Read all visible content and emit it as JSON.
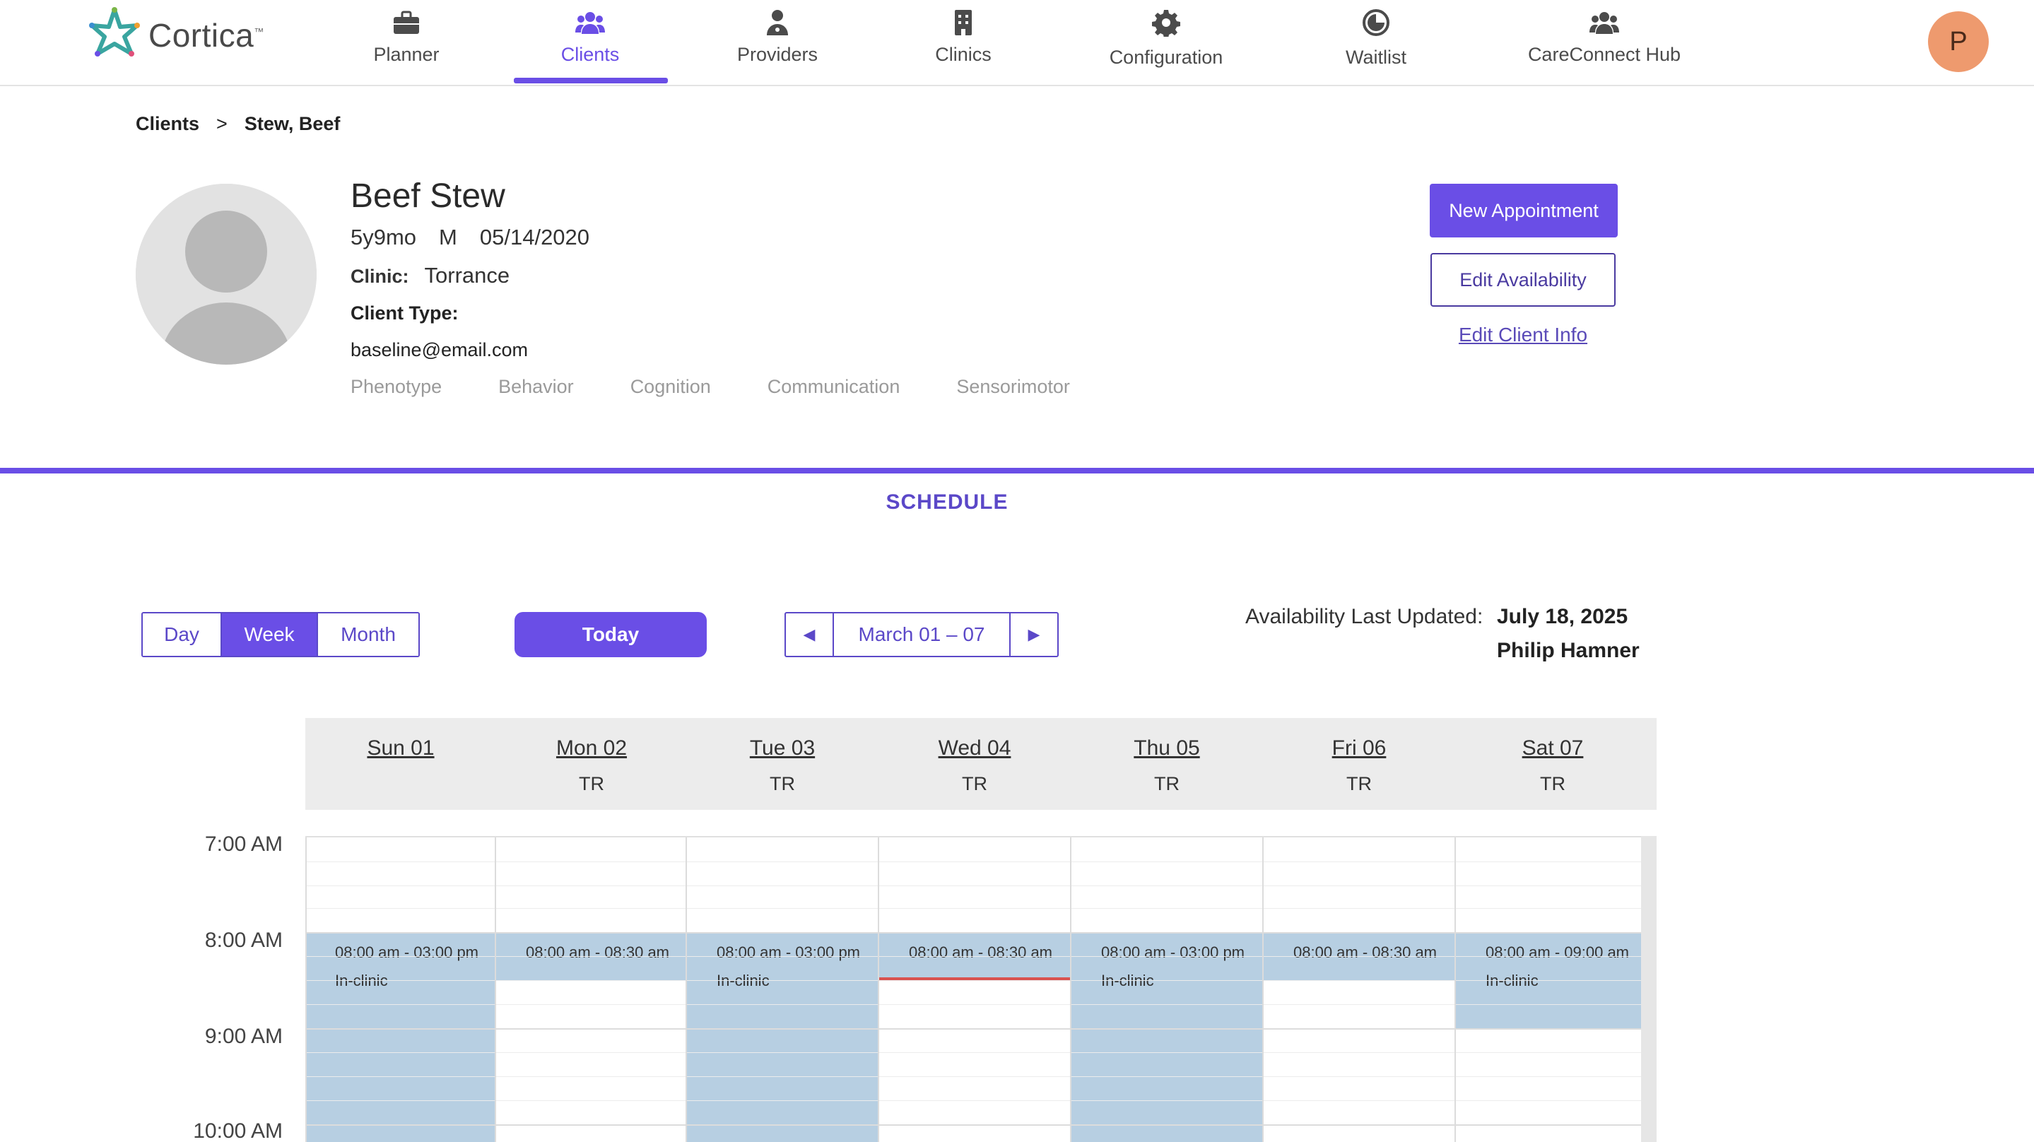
{
  "app": {
    "logo_text": "Cortica",
    "logo_tm": "™"
  },
  "nav": {
    "items": [
      {
        "label": "Planner",
        "icon": "briefcase-icon"
      },
      {
        "label": "Clients",
        "icon": "users-icon"
      },
      {
        "label": "Providers",
        "icon": "doctor-icon"
      },
      {
        "label": "Clinics",
        "icon": "building-icon"
      },
      {
        "label": "Configuration",
        "icon": "gear-icon"
      },
      {
        "label": "Waitlist",
        "icon": "clock-icon"
      },
      {
        "label": "CareConnect Hub",
        "icon": "group-icon"
      }
    ],
    "active": "Clients",
    "user_initial": "P"
  },
  "breadcrumb": {
    "root": "Clients",
    "sep": ">",
    "current": "Stew, Beef"
  },
  "client": {
    "name": "Beef Stew",
    "age": "5y9mo",
    "sex": "M",
    "dob": "05/14/2020",
    "clinic_label": "Clinic:",
    "clinic": "Torrance",
    "client_type_label": "Client Type:",
    "email": "baseline@email.com",
    "tags": [
      "Phenotype",
      "Behavior",
      "Cognition",
      "Communication",
      "Sensorimotor"
    ]
  },
  "actions": {
    "new_appointment": "New Appointment",
    "edit_availability": "Edit Availability",
    "edit_client_info": "Edit Client Info"
  },
  "schedule": {
    "title": "SCHEDULE",
    "views": [
      "Day",
      "Week",
      "Month"
    ],
    "active_view": "Week",
    "today": "Today",
    "range": "March 01 – 07",
    "availability_label": "Availability Last Updated:",
    "availability_date": "July 18, 2025",
    "availability_by": "Philip Hamner",
    "days": [
      {
        "name": "Sun 01",
        "code": ""
      },
      {
        "name": "Mon 02",
        "code": "TR"
      },
      {
        "name": "Tue 03",
        "code": "TR"
      },
      {
        "name": "Wed 04",
        "code": "TR"
      },
      {
        "name": "Thu 05",
        "code": "TR"
      },
      {
        "name": "Fri 06",
        "code": "TR"
      },
      {
        "name": "Sat 07",
        "code": "TR"
      }
    ],
    "times": [
      "7:00 AM",
      "8:00 AM",
      "9:00 AM",
      "10:00 AM"
    ],
    "blocks": [
      {
        "time": "08:00 am - 03:00 pm",
        "type": "In-clinic"
      },
      {
        "time": "08:00 am - 08:30 am",
        "type": ""
      },
      {
        "time": "08:00 am - 03:00 pm",
        "type": "In-clinic"
      },
      {
        "time": "08:00 am - 08:30 am",
        "type": ""
      },
      {
        "time": "08:00 am - 03:00 pm",
        "type": "In-clinic"
      },
      {
        "time": "08:00 am - 08:30 am",
        "type": ""
      },
      {
        "time": "08:00 am - 09:00 am",
        "type": "In-clinic"
      }
    ]
  },
  "colors": {
    "accent": "#6a4ee6",
    "availability_block": "#b7cfe2",
    "current_time_line": "#d9534f",
    "avatar_bg": "#ee9a6e"
  }
}
